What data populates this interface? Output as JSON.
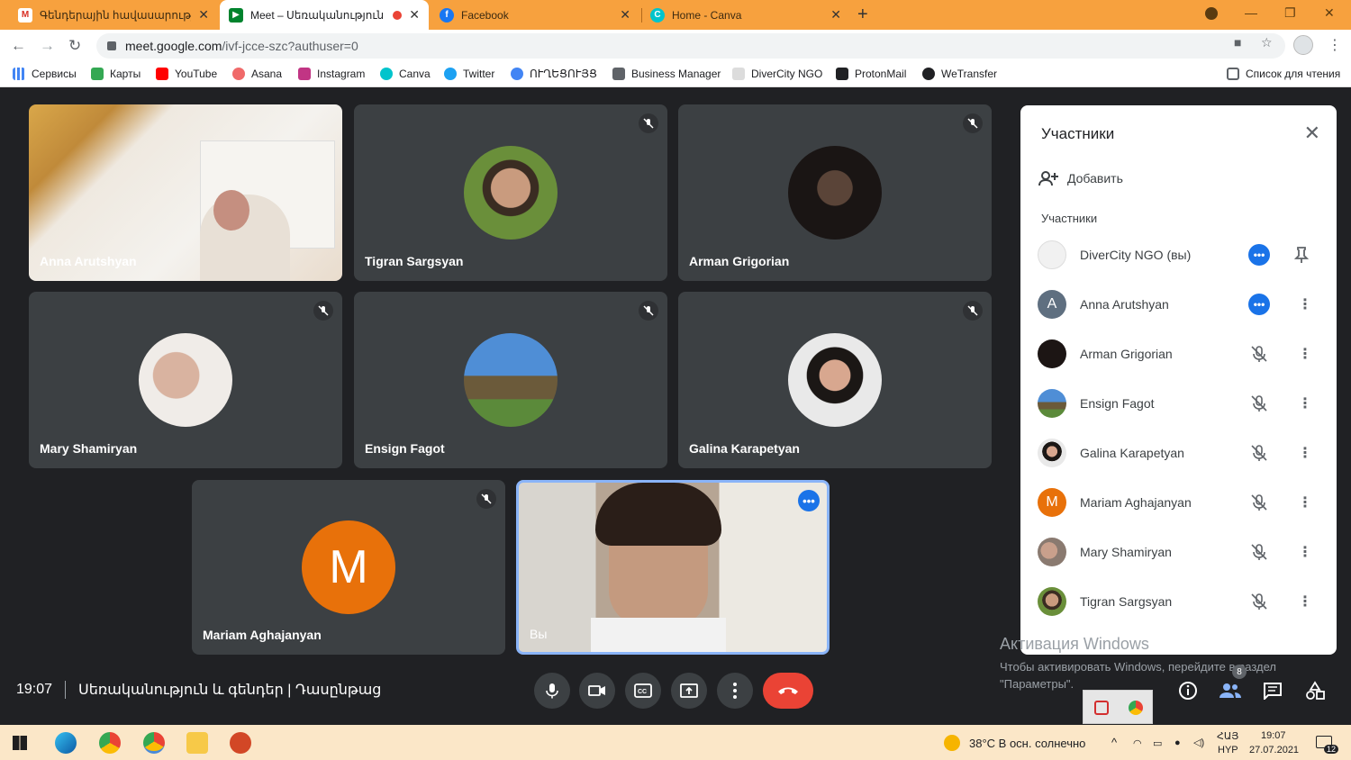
{
  "browser": {
    "tabs": [
      {
        "title": "Գենդերային հավասարությա",
        "favicon": "gmail-icon",
        "active": false
      },
      {
        "title": "Meet – Սեռականություն և",
        "favicon": "meet-icon",
        "active": true
      },
      {
        "title": "Facebook",
        "favicon": "facebook-icon",
        "active": false
      },
      {
        "title": "Home - Canva",
        "favicon": "canva-icon",
        "active": false
      }
    ],
    "url_main": "meet.google.com",
    "url_rest": "/ivf-jcce-szc?authuser=0",
    "bookmarks": [
      "Сервисы",
      "Карты",
      "YouTube",
      "Asana",
      "Instagram",
      "Canva",
      "Twitter",
      "ՈՒՂԵՑՈՒՅՑ",
      "Business Manager",
      "DiverCity NGO",
      "ProtonMail",
      "WeTransfer"
    ],
    "reading_list": "Список для чтения"
  },
  "meeting": {
    "tiles": [
      {
        "name": "Anna Arutshyan",
        "type": "video"
      },
      {
        "name": "Tigran Sargsyan",
        "type": "avatar",
        "muted": true
      },
      {
        "name": "Arman Grigorian",
        "type": "avatar",
        "muted": true
      },
      {
        "name": "Mary Shamiryan",
        "type": "avatar",
        "muted": true
      },
      {
        "name": "Ensign Fagot",
        "type": "avatar",
        "muted": true
      },
      {
        "name": "Galina Karapetyan",
        "type": "avatar",
        "muted": true
      },
      {
        "name": "Mariam Aghajanyan",
        "type": "letter",
        "letter": "M",
        "muted": true
      },
      {
        "name": "Вы",
        "type": "self"
      }
    ],
    "time": "19:07",
    "title": "Սեռականություն և գենդեր | Դասընթաց",
    "participants_badge": "8"
  },
  "panel": {
    "title": "Участники",
    "add_label": "Добавить",
    "section_label": "Участники",
    "participants": [
      {
        "name": "DiverCity NGO (вы)",
        "state": "speaking"
      },
      {
        "name": "Anna Arutshyan",
        "state": "speaking",
        "initial": "A"
      },
      {
        "name": "Arman Grigorian",
        "state": "muted"
      },
      {
        "name": "Ensign Fagot",
        "state": "muted"
      },
      {
        "name": "Galina Karapetyan",
        "state": "muted"
      },
      {
        "name": "Mariam Aghajanyan",
        "state": "muted",
        "initial": "M"
      },
      {
        "name": "Mary Shamiryan",
        "state": "muted"
      },
      {
        "name": "Tigran Sargsyan",
        "state": "muted"
      }
    ]
  },
  "watermark": {
    "line1": "Активация Windows",
    "line2": "Чтобы активировать Windows, перейдите в раздел \"Параметры\"."
  },
  "taskbar": {
    "weather": "38°C  В осн. солнечно",
    "lang_top": "ՀԱՅ",
    "lang_bottom": "HYP",
    "clock_time": "19:07",
    "clock_date": "27.07.2021",
    "notif_count": "12"
  }
}
